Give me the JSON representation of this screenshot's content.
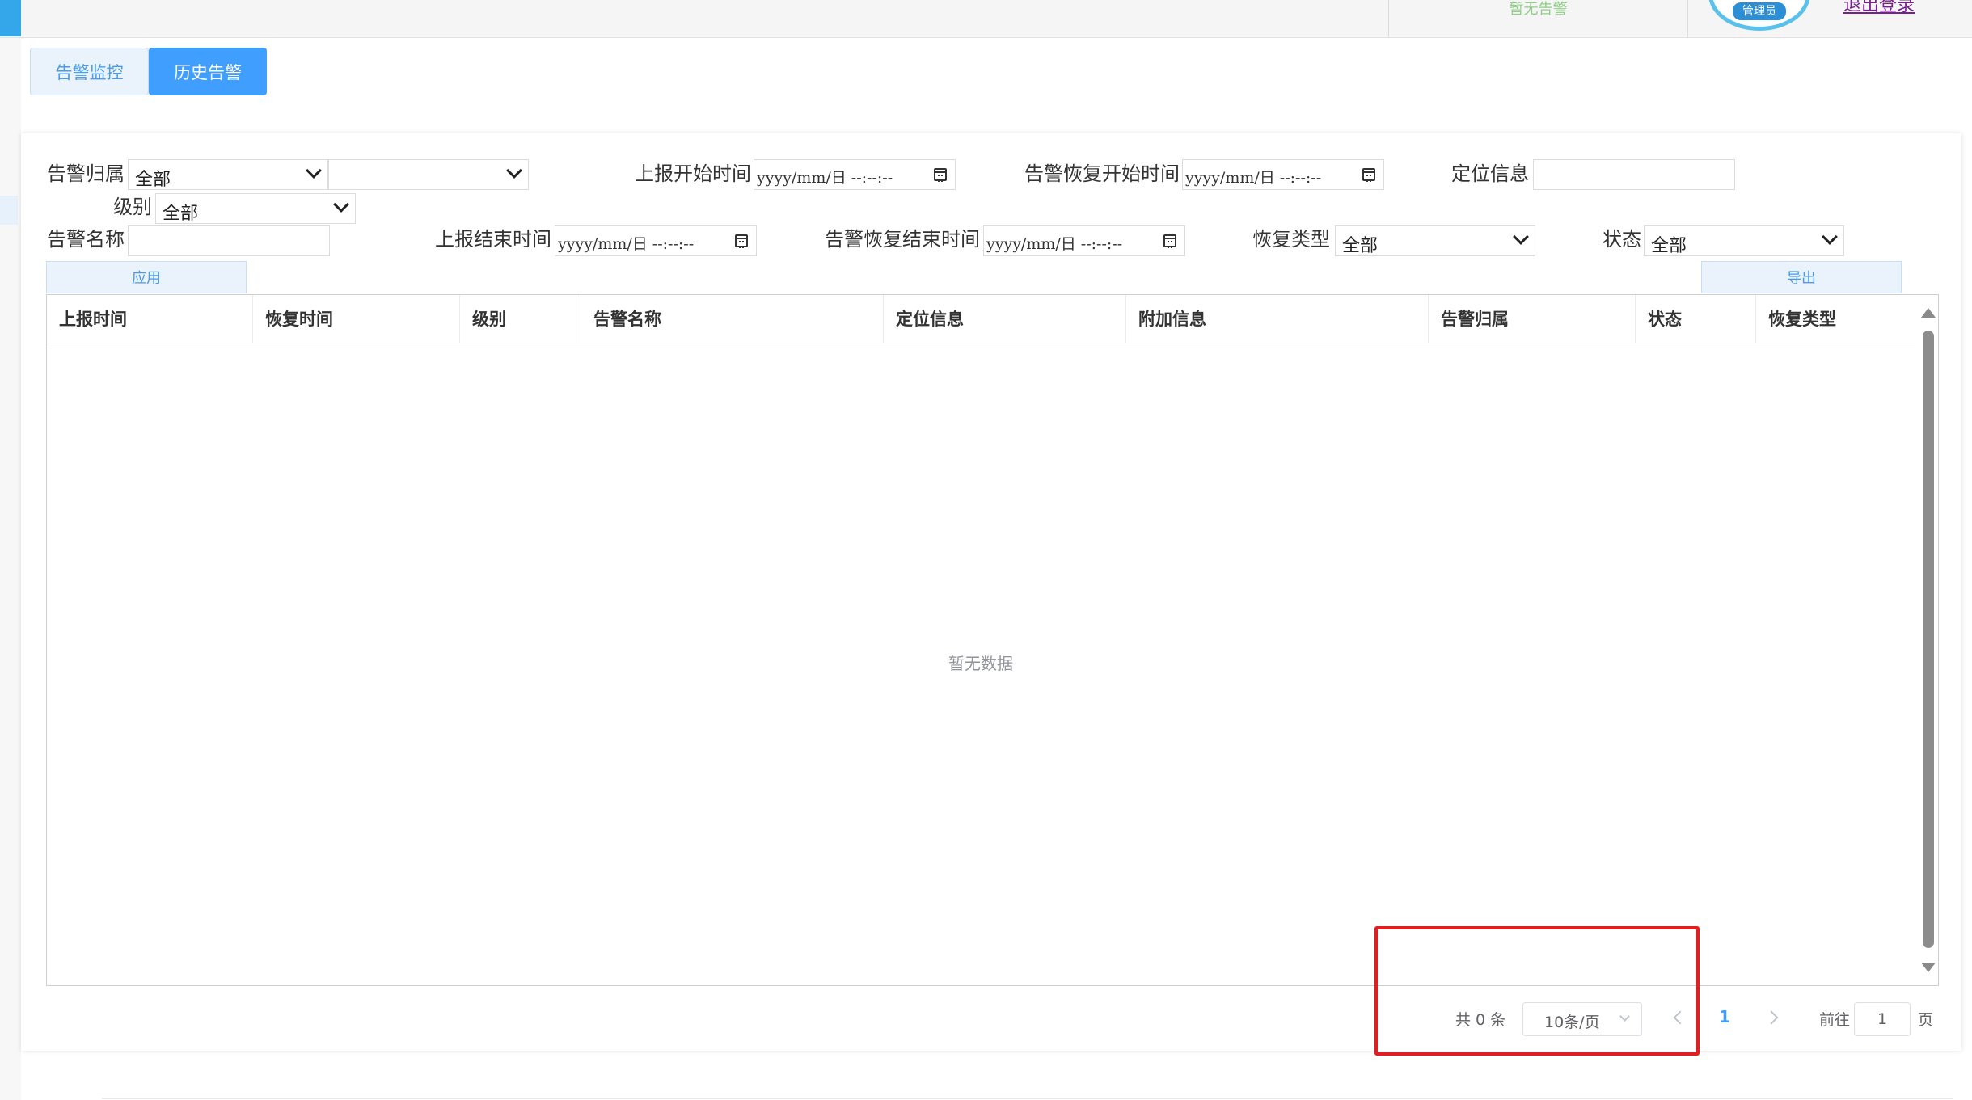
{
  "header": {
    "alarm_status": "暂无告警",
    "user_role_badge": "管理员",
    "logout_label": "退出登录"
  },
  "tabs": [
    {
      "label": "告警监控",
      "active": false
    },
    {
      "label": "历史告警",
      "active": true
    }
  ],
  "filters": {
    "alarm_owner_label": "告警归属",
    "alarm_owner_value": "全部",
    "alarm_owner_sub_value": "",
    "level_label": "级别",
    "level_value": "全部",
    "alarm_name_label": "告警名称",
    "alarm_name_value": "",
    "report_start_label": "上报开始时间",
    "report_end_label": "上报结束时间",
    "recover_start_label": "告警恢复开始时间",
    "recover_end_label": "告警恢复结束时间",
    "datetime_placeholder": "yyyy/mm/日 --:--:--",
    "location_label": "定位信息",
    "location_value": "",
    "recovery_type_label": "恢复类型",
    "recovery_type_value": "全部",
    "status_label": "状态",
    "status_value": "全部",
    "apply_label": "应用",
    "export_label": "导出"
  },
  "table": {
    "columns": [
      "上报时间",
      "恢复时间",
      "级别",
      "告警名称",
      "定位信息",
      "附加信息",
      "告警归属",
      "状态",
      "恢复类型"
    ],
    "rows": [],
    "empty_text": "暂无数据"
  },
  "pagination": {
    "total_text": "共 0 条",
    "page_size": "10条/页",
    "current_page": "1",
    "goto_label": "前往",
    "goto_value": "1",
    "page_suffix": "页"
  },
  "colors": {
    "primary": "#409eff",
    "annotation": "#e02020"
  }
}
